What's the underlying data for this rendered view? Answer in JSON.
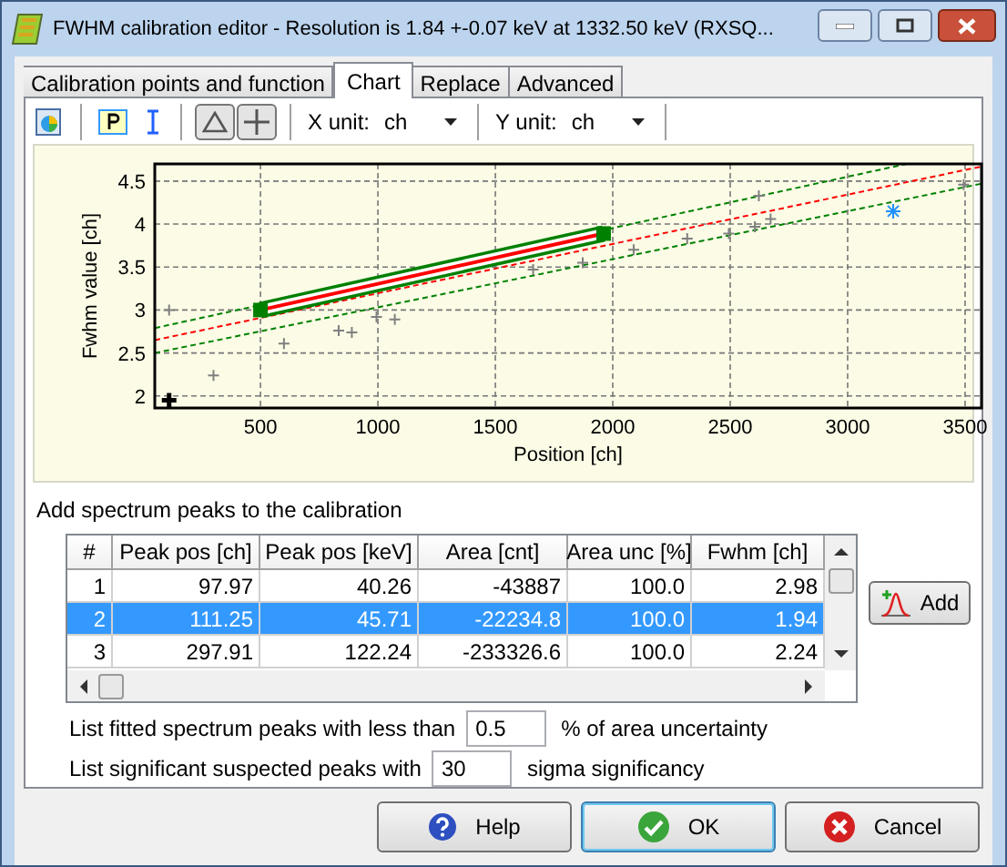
{
  "window": {
    "title": "FWHM calibration editor - Resolution is 1.84 +-0.07 keV at 1332.50 keV (RXSQ..."
  },
  "tabs": [
    {
      "label": "Calibration points and function",
      "selected": false
    },
    {
      "label": "Chart",
      "selected": true
    },
    {
      "label": "Replace",
      "selected": false
    },
    {
      "label": "Advanced",
      "selected": false
    }
  ],
  "toolbar": {
    "tools": [
      {
        "kind": "chart"
      },
      {
        "kind": "sep"
      },
      {
        "kind": "p"
      },
      {
        "kind": "errorbar"
      },
      {
        "kind": "sep"
      },
      {
        "kind": "triangle"
      },
      {
        "kind": "plus"
      },
      {
        "kind": "sep"
      }
    ],
    "x_unit": {
      "label": "X unit:",
      "value": "ch"
    },
    "y_unit": {
      "label": "Y unit:",
      "value": "ch"
    }
  },
  "chart": {
    "chart_data": {
      "type": "scatter",
      "grid": true,
      "xlabel": "Position [ch]",
      "ylabel": "Fwhm value [ch]",
      "xlim": [
        50,
        3570
      ],
      "ylim": [
        1.86,
        4.7
      ],
      "xticks": [
        500,
        1000,
        1500,
        2000,
        2500,
        3000,
        3500
      ],
      "yticks": [
        {
          "value": 2,
          "label": "2"
        },
        {
          "value": 2.5,
          "label": "2.5"
        },
        {
          "value": 3,
          "label": "3"
        },
        {
          "value": 3.5,
          "label": "3.5"
        },
        {
          "value": 4,
          "label": "4"
        },
        {
          "value": 4.5,
          "label": "4.5"
        }
      ],
      "series": [
        {
          "type": "line",
          "line_style": "dashed",
          "color": "#008000",
          "x": [
            50,
            3250
          ],
          "values": [
            2.79,
            4.7
          ]
        },
        {
          "type": "line",
          "line_style": "dashed",
          "color": "#008000",
          "x": [
            50,
            3570
          ],
          "values": [
            2.5,
            4.47
          ]
        },
        {
          "type": "line",
          "line_style": "dashed",
          "color": "#ff0000",
          "x": [
            50,
            3570
          ],
          "values": [
            2.65,
            4.67
          ]
        },
        {
          "type": "line",
          "line_style": "solid",
          "color": "#008000",
          "x": [
            500,
            1961
          ],
          "values": [
            3.0,
            3.89
          ]
        },
        {
          "type": "line",
          "line_style": "solid",
          "color": "#ff0000",
          "x": [
            500,
            1961
          ],
          "values": [
            3.0,
            3.89
          ]
        },
        {
          "type": "scatter",
          "marker": "cross",
          "color": "#808080",
          "x": [
            111,
            300,
            600,
            833,
            889,
            994,
            1072,
            1661,
            1872,
            2089,
            2317,
            2494,
            2605,
            2622,
            2672,
            3494
          ],
          "values": [
            3.0,
            2.24,
            2.61,
            2.76,
            2.74,
            2.92,
            2.89,
            3.47,
            3.55,
            3.7,
            3.83,
            3.89,
            3.97,
            4.33,
            4.06,
            4.46
          ]
        },
        {
          "type": "scatter",
          "marker": "square",
          "color": "#008000",
          "x": [
            500,
            1961
          ],
          "values": [
            3.0,
            3.89
          ]
        },
        {
          "type": "scatter",
          "marker": "cross",
          "color": "#1e90ff",
          "x": [
            3194
          ],
          "values": [
            4.15
          ]
        },
        {
          "type": "scatter",
          "marker": "cross",
          "color": "#000000",
          "x": [
            111
          ],
          "values": [
            1.95
          ]
        }
      ]
    }
  },
  "peaks": {
    "title": "Add spectrum peaks to the calibration",
    "columns": [
      "#",
      "Peak pos [ch]",
      "Peak pos [keV]",
      "Area [cnt]",
      "Area unc [%]",
      "Fwhm [ch]"
    ],
    "rows": [
      {
        "cells": [
          "1",
          "97.97",
          "40.26",
          "-43887",
          "100.0",
          "2.98"
        ],
        "selected": false
      },
      {
        "cells": [
          "2",
          "111.25",
          "45.71",
          "-22234.8",
          "100.0",
          "1.94"
        ],
        "selected": true
      },
      {
        "cells": [
          "3",
          "297.91",
          "122.24",
          "-233326.6",
          "100.0",
          "2.24"
        ],
        "selected": false
      }
    ],
    "add_button": "Add"
  },
  "filters": [
    {
      "before": "List fitted spectrum peaks with less than",
      "value": "0.5",
      "after": "% of area uncertainty"
    },
    {
      "before": "List significant suspected peaks with",
      "value": "30",
      "after": "sigma significancy"
    }
  ],
  "buttons": [
    {
      "kind": "help",
      "label": "Help",
      "focused": false
    },
    {
      "kind": "ok",
      "label": "OK",
      "focused": true
    },
    {
      "kind": "cancel",
      "label": "Cancel",
      "focused": false
    }
  ]
}
